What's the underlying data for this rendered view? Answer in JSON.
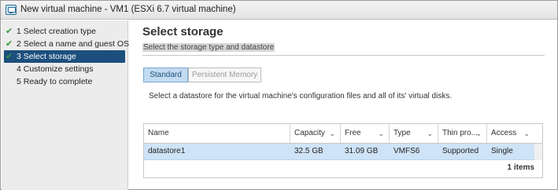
{
  "window": {
    "title": "New virtual machine - VM1 (ESXi 6.7 virtual machine)",
    "icon": "vm-icon"
  },
  "sidebar": {
    "steps": [
      {
        "label": "1 Select creation type",
        "completed": true,
        "active": false
      },
      {
        "label": "2 Select a name and guest OS",
        "completed": true,
        "active": false
      },
      {
        "label": "3 Select storage",
        "completed": true,
        "active": true
      },
      {
        "label": "4 Customize settings",
        "completed": false,
        "active": false
      },
      {
        "label": "5 Ready to complete",
        "completed": false,
        "active": false
      }
    ]
  },
  "main": {
    "title": "Select storage",
    "subtitle": "Select the storage type and datastore",
    "tabs": [
      {
        "label": "Standard",
        "selected": true
      },
      {
        "label": "Persistent Memory",
        "selected": false
      }
    ],
    "description": "Select a datastore for the virtual machine's configuration files and all of its' virtual disks.",
    "table": {
      "columns": [
        "Name",
        "Capacity",
        "Free",
        "Type",
        "Thin pro...",
        "Access"
      ],
      "rows": [
        [
          "datastore1",
          "32.5 GB",
          "31.09 GB",
          "VMFS6",
          "Supported",
          "Single"
        ]
      ],
      "count": "1 items"
    }
  },
  "colors": {
    "active_step": "#1d4f7e",
    "check": "#2e9a3a",
    "selected_row": "#cfe3f7",
    "selected_tab": "#c3dcf2"
  }
}
